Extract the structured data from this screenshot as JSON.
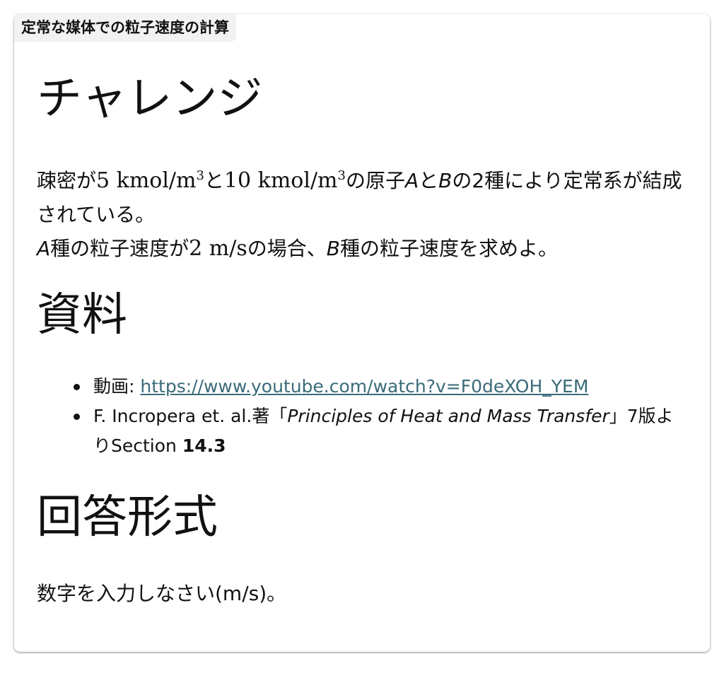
{
  "card": {
    "title": "定常な媒体での粒子速度の計算"
  },
  "challenge": {
    "heading": "チャレンジ",
    "line1_prefix": "疎密が",
    "conc_a": "5 kmol/m",
    "conc_a_exp": "3",
    "and_1": "と",
    "conc_b": "10 kmol/m",
    "conc_b_exp": "3",
    "of_atoms": "の原子",
    "var_a": "A",
    "and_2": "と",
    "var_b": "B",
    "suffix_1": "の2種により定常系が結成されている。",
    "line2_var_a": "A",
    "line2_text1": "種の粒子速度が",
    "velocity": "2 m/s",
    "line2_text2": "の場合、",
    "line2_var_b": "B",
    "line2_text3": "種の粒子速度を求めよ。"
  },
  "materials": {
    "heading": "資料",
    "video_label": "動画: ",
    "video_url": "https://www.youtube.com/watch?v=F0deXOH_YEM",
    "book_prefix": "F. Incropera et. al.著「",
    "book_title": "Principles of Heat and Mass Transfer",
    "book_suffix": "」7版よりSection ",
    "book_section": "14.3"
  },
  "answer_format": {
    "heading": "回答形式",
    "instruction": "数字を入力しなさい(m/s)。"
  },
  "colors": {
    "link": "#3a6b78",
    "title_tab_bg": "#f2f2f2"
  }
}
